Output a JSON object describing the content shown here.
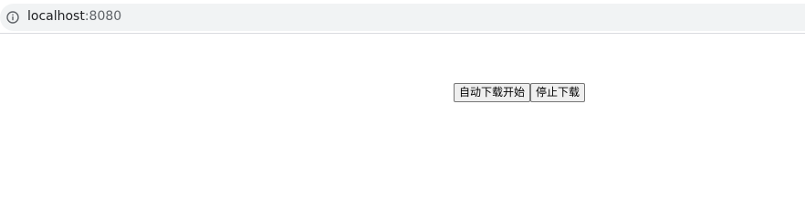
{
  "browser": {
    "url_host": "localhost",
    "url_port": ":8080",
    "info_icon": "info-circle-icon"
  },
  "page": {
    "start_download_label": "自动下载开始",
    "stop_download_label": "停止下载"
  }
}
